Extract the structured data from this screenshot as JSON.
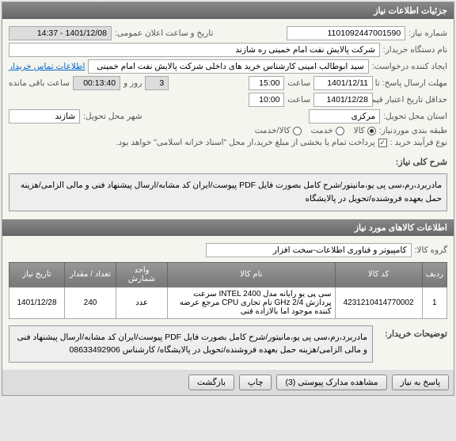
{
  "header": {
    "title": "جزئیات اطلاعات نياز"
  },
  "basic": {
    "need_number_label": "شماره نياز:",
    "need_number": "1101092447001590",
    "announce_label": "تاریخ و ساعت اعلان عمومی:",
    "announce_value": "1401/12/08 - 14:37",
    "buyer_label": "نام دستگاه خریدار:",
    "buyer_value": "شرکت پالایش نفت امام خمینی ره شازند",
    "creator_label": "ایجاد کننده درخواست:",
    "creator_value": "سید ابوطالب امینی کارشناس خرید های داخلی شرکت پالایش نفت امام خمینی",
    "contact_link": "اطلاعات تماس خریدار",
    "deadline_label": "حداقل تاریخ اعتبار قیمت تا تاریخ:",
    "deadline_send_label": "مهلت ارسال پاسخ: تا تاریخ:",
    "deadline_date": "1401/12/11",
    "deadline_time_label": "ساعت",
    "deadline_time": "15:00",
    "remain_days": "3",
    "remain_days_label": "روز و",
    "remain_time": "00:13:40",
    "remain_label": "ساعت باقی مانده",
    "deadline2_date": "1401/12/28",
    "deadline2_time": "10:00",
    "province_label": "استان محل تحویل:",
    "province": "مرکزی",
    "city_label": "شهر محل تحویل:",
    "city": "شازند",
    "goods_service_label": "طبقه بندی موردنیاز:",
    "goods": "کالا",
    "service": "خدمت",
    "goods_service": "کالا/خدمت",
    "process_label": "نوع فرآیند خرید :",
    "payment_note": "پرداخت تمام یا بخشی از مبلغ خرید،از محل \"اسناد خزانه اسلامی\" خواهد بود."
  },
  "desc": {
    "label": "شرح کلی نياز:",
    "text": "مادربرد،رم،سی پی یو،مانیتور/شرح کامل بصورت فایل PDF پیوست/ایران کد مشابه/ارسال پیشنهاد فنی و مالی الزامی/هزینه حمل بعهده فروشنده/تحویل در پالایشگاه"
  },
  "goods_info": {
    "header": "اطلاعات کالاهای مورد نیاز",
    "group_label": "گروه کالا:",
    "group_value": "کامپیوتر و فناوری اطلاعات-سخت افزار"
  },
  "table": {
    "headers": [
      "ردیف",
      "کد کالا",
      "نام کالا",
      "واحد شمارش",
      "تعداد / مقدار",
      "تاریخ نیاز"
    ],
    "rows": [
      {
        "idx": "1",
        "code": "4231210414770002",
        "name": "سی پی یو رایانه مدل INTEL 2400 سرعت پردازش GHz 2/4 نام تجاری CPU مرجع عرضه کننده موجود اما بالازاده فنی",
        "unit": "عدد",
        "qty": "240",
        "date": "1401/12/28"
      }
    ]
  },
  "buyer_notes": {
    "label": "توضیحات خریدار:",
    "text": "مادربرد،رم،سی پی یو،مانیتور/شرح کامل بصورت فایل PDF پیوست/ایران کد مشابه/ارسال پیشنهاد فنی و مالی الزامی/هزینه حمل بعهده فروشنده/تحویل در پالایشگاه/ کارشناس 08633492906"
  },
  "footer": {
    "reply": "پاسخ به نیاز",
    "attachments": "مشاهده مدارک پیوستی (3)",
    "print": "چاپ",
    "back": "بازگشت"
  }
}
